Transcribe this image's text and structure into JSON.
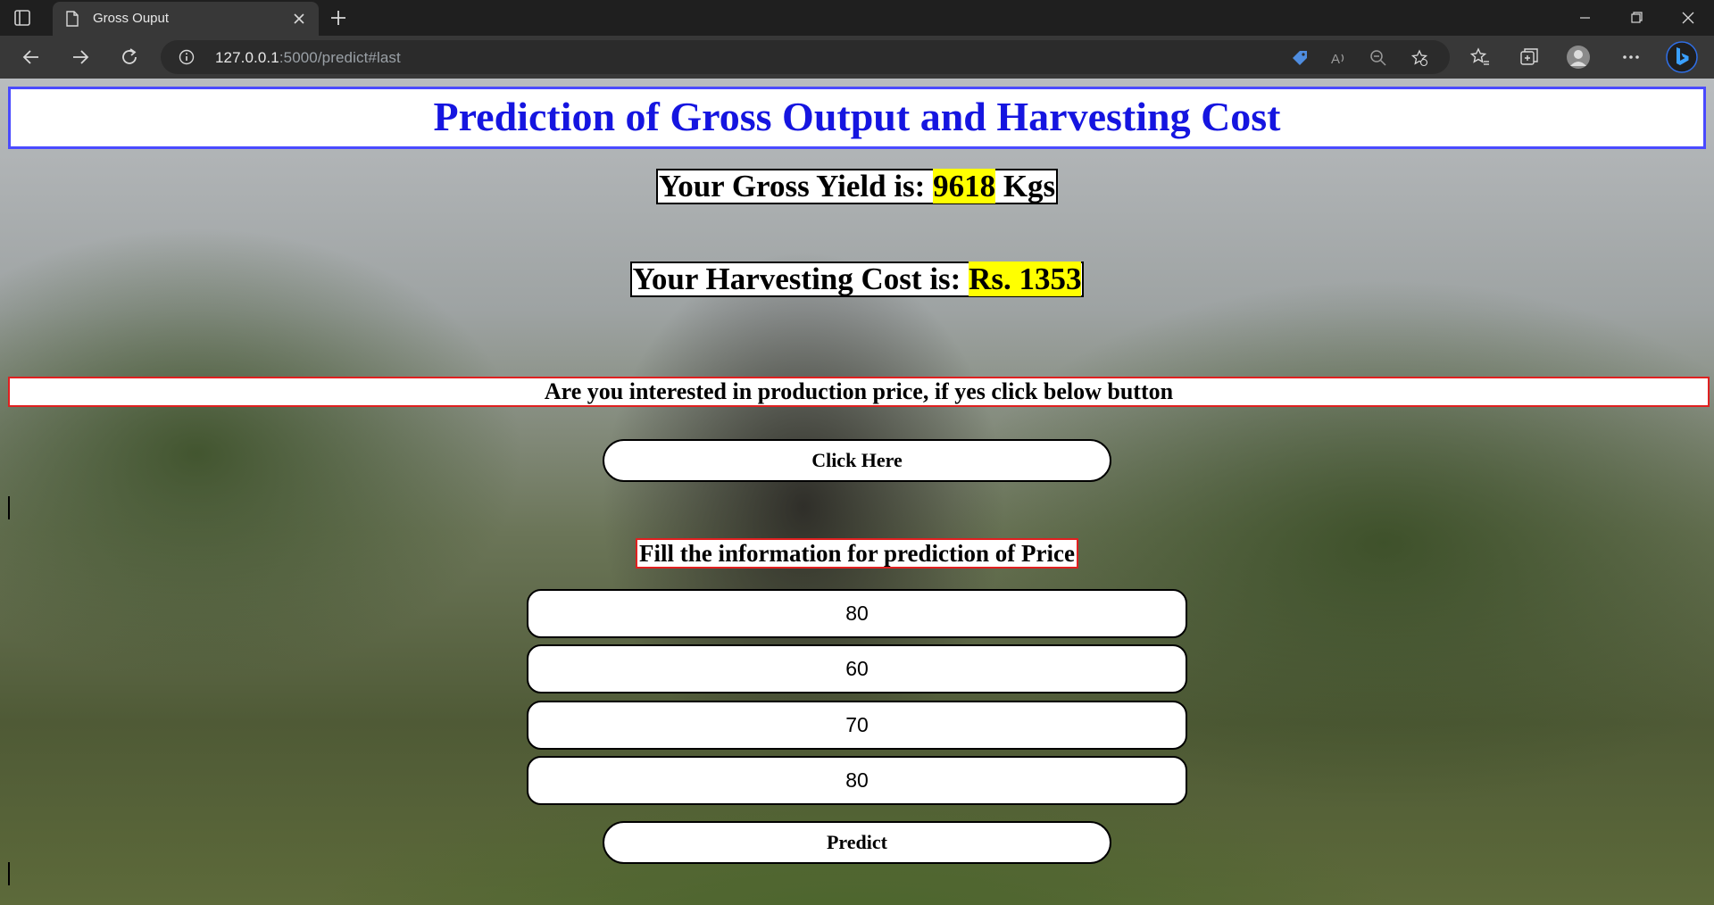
{
  "browser": {
    "tab_title": "Gross Ouput",
    "url_host": "127.0.0.1",
    "url_rest": ":5000/predict#last"
  },
  "page": {
    "title": "Prediction of Gross Output and Harvesting Cost",
    "gross_yield": {
      "prefix": "Your Gross Yield is: ",
      "value": "9618",
      "suffix": " Kgs"
    },
    "harvesting_cost": {
      "prefix": "Your Harvesting Cost is: ",
      "value": "Rs. 1353"
    },
    "question": "Are you interested in production price, if yes click below button",
    "click_here_label": "Click Here",
    "fill_label": "Fill the information for prediction of Price",
    "fields": [
      "80",
      "60",
      "70",
      "80"
    ],
    "predict_label": "Predict"
  },
  "colors": {
    "title_text": "#1515e0",
    "title_border": "#4a4aff",
    "highlight": "#ffff00",
    "question_border": "#e02020"
  }
}
